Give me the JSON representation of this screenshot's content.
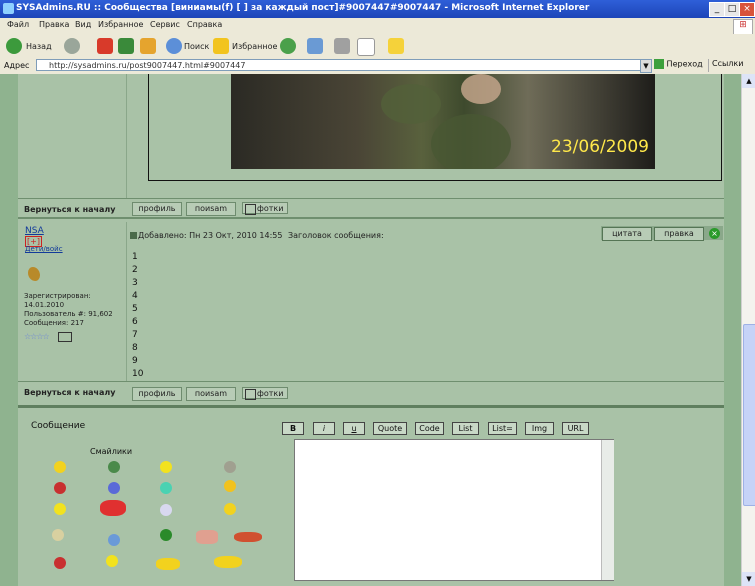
{
  "window": {
    "title": "SYSAdmins.RU :: Сообщества [виниамы(f) [ ] за каждый пост]#9007447#9007447 - Microsoft Internet Explorer"
  },
  "menu": [
    "Файл",
    "Правка",
    "Вид",
    "Избранное",
    "Сервис",
    "Справка"
  ],
  "toolbar": {
    "back": "Назад",
    "search": "Поиск",
    "favorites": "Избранное"
  },
  "address": {
    "label": "Адрес",
    "value": "http://sysadmins.ru/post9007447.html#9007447",
    "go": "Переход",
    "links": "Ссылки"
  },
  "photo": {
    "date": "23/06/2009"
  },
  "nav": {
    "back_to_top": "Вернуться к началу",
    "profile": "профиль",
    "pm": "поиsam",
    "photos": "фотки"
  },
  "post": {
    "author": "NSA",
    "author_tag": "[+]",
    "status": "Дети/войс",
    "stats": "Зарегистрирован:\n14.01.2010\nПользователь #: 91,602\nСообщения: 217",
    "added": "Добавлено: Пн 23 Окт, 2010 14:55",
    "subject": "Заголовок сообщения:",
    "quote_btn": "цитата",
    "edit_btn": "правка",
    "lines": [
      "1",
      "2",
      "3",
      "4",
      "5",
      "6",
      "7",
      "8",
      "9",
      "10"
    ]
  },
  "reply": {
    "message_label": "Сообщение",
    "smilies_label": "Смайлики",
    "format_buttons": [
      "B",
      "i",
      "u",
      "Quote",
      "Code",
      "List",
      "List=",
      "Img",
      "URL"
    ]
  }
}
